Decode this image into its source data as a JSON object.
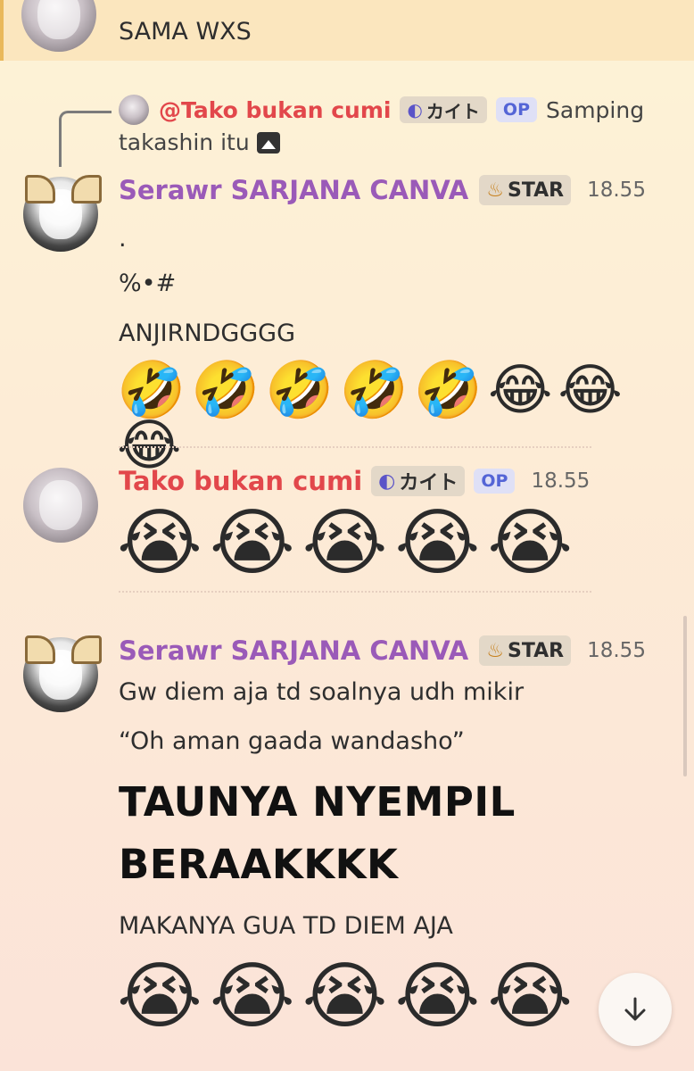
{
  "top_message": {
    "text": "SAMA WXS"
  },
  "reply": {
    "mention": "@Tako bukan cumi",
    "tag": "カイト",
    "op": "OP",
    "preview_line1": "Samping",
    "preview_line2": "takashin itu"
  },
  "messages": [
    {
      "author": "Serawr SARJANA CANVA",
      "tag": "STAR",
      "time": "18.55",
      "lines": [
        ".",
        "%•#",
        "ANJIRNDGGGG"
      ],
      "emoji": "🤣🤣🤣🤣🤣😂😂😂"
    },
    {
      "author": "Tako bukan cumi",
      "tag": "カイト",
      "op": "OP",
      "time": "18.55",
      "emoji": "😭😭😭😭😭"
    },
    {
      "author": "Serawr SARJANA CANVA",
      "tag": "STAR",
      "time": "18.55",
      "lines": [
        "Gw diem aja td soalnya udh mikir",
        "“Oh aman gaada wandasho”"
      ],
      "big_lines": [
        "TAUNYA NYEMPIL",
        "BERAAKKKK"
      ],
      "after": "MAKANYA GUA TD DIEM AJA",
      "emoji": "😭😭😭😭😭"
    }
  ],
  "icons": {
    "tag_star": "flame-icon",
    "tag_kaito": "moon-icon",
    "attachment": "image-icon",
    "scroll": "arrow-down-icon"
  }
}
